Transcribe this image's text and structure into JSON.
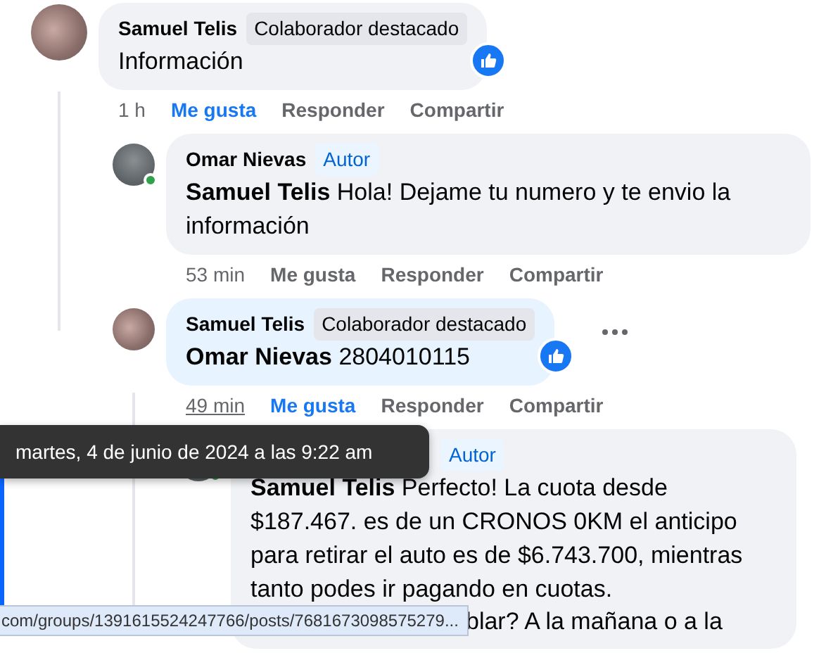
{
  "comments": [
    {
      "author": "Samuel Telis",
      "badge": {
        "text": "Colaborador destacado",
        "kind": "contributor"
      },
      "text": "Información",
      "reaction": true,
      "time": "1 h",
      "actions": [
        {
          "label": "Me gusta",
          "selected": true
        },
        {
          "label": "Responder",
          "selected": false
        },
        {
          "label": "Compartir",
          "selected": false
        }
      ],
      "children": [
        {
          "author": "Omar Nievas",
          "badge": {
            "text": "Autor",
            "kind": "author"
          },
          "online": true,
          "mention": "Samuel Telis",
          "text": "Hola! Dejame tu numero y te envio la información",
          "time": "53 min",
          "actions": [
            {
              "label": "Me gusta",
              "selected": false
            },
            {
              "label": "Responder",
              "selected": false
            },
            {
              "label": "Compartir",
              "selected": false
            }
          ]
        },
        {
          "author": "Samuel Telis",
          "badge": {
            "text": "Colaborador destacado",
            "kind": "contributor"
          },
          "mention": "Omar Nievas",
          "text": "2804010115",
          "reaction": true,
          "highlighted": true,
          "more_menu": true,
          "time": "49 min",
          "time_underlined": true,
          "actions": [
            {
              "label": "Me gusta",
              "selected": true
            },
            {
              "label": "Responder",
              "selected": false
            },
            {
              "label": "Compartir",
              "selected": false
            }
          ],
          "children": [
            {
              "badge": {
                "text": "Autor",
                "kind": "author"
              },
              "online": true,
              "mention": "Samuel Telis",
              "text": "Perfecto! La cuota desde $187.467. es de un CRONOS 0KM el anticipo para retirar el auto es de $6.743.700, mientras tanto podes ir pagando en cuotas.",
              "extra_line": "blar? A la mañana o a la"
            }
          ]
        }
      ]
    }
  ],
  "tooltip": "martes, 4 de junio de 2024 a las 9:22 am",
  "status_bar": "com/groups/1391615524247766/posts/7681673098575279..."
}
